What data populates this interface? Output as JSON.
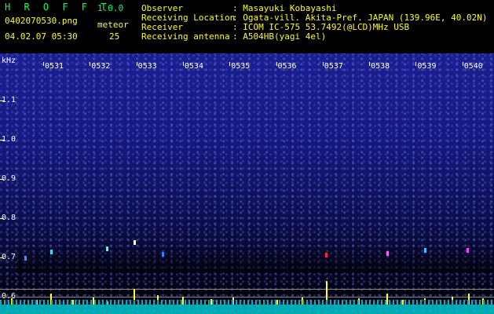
{
  "header": {
    "app_name": "H R O F F T",
    "version": "1.0.0",
    "filename": "0402070530.png",
    "meteor_label": "meteor",
    "datetime": "04.02.07 05:30",
    "meteor_count": "25",
    "observer_label": "Observer",
    "observer_value": ": Masayuki Kobayashi",
    "location_label": "Receiving Location",
    "location_value": ": Ogata-vill. Akita-Pref. JAPAN (139.96E, 40.02N)",
    "receiver_label": "Receiver",
    "receiver_value": ": ICOM IC-575 53.7492(@LCD)MHz USB",
    "antenna_label": "Receiving antenna",
    "antenna_value": ": A504HB(yagi 4el)"
  },
  "axis": {
    "unit": "kHz",
    "y_ticks": [
      "1.1",
      "1.0",
      "0.9",
      "0.8",
      "0.7",
      "0.6"
    ],
    "x_ticks": [
      "0531",
      "0532",
      "0533",
      "0534",
      "0535",
      "0536",
      "0537",
      "0538",
      "0539",
      "0540"
    ]
  },
  "colors": {
    "header_text": "#ffff00",
    "title_text": "#00ff66",
    "background_top": "#1a1f90",
    "meteor_trace": "#ffff30",
    "noise": "#00c8d0"
  }
}
